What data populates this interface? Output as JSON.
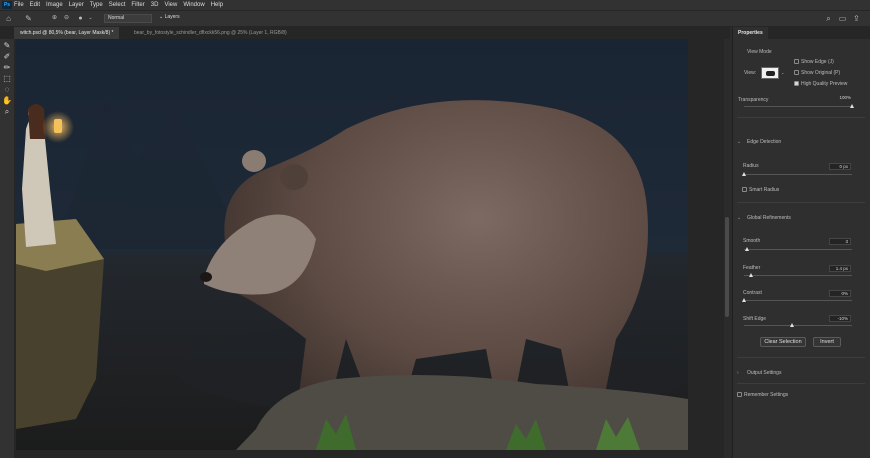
{
  "menubar": {
    "app_icon": "Ps",
    "items": [
      "File",
      "Edit",
      "Image",
      "Layer",
      "Type",
      "Select",
      "Filter",
      "3D",
      "View",
      "Window",
      "Help"
    ]
  },
  "options_bar": {
    "mode_value": "Normal",
    "layer_value": "Layers"
  },
  "document_tabs": [
    {
      "label": "witch.psd @ 80,5% (bear, Layer Mask/8) *",
      "active": true
    },
    {
      "label": "bear_by_fotostyle_schindler_dflxckk56.png @ 25% (Layer 1, RGB/8)",
      "active": false
    }
  ],
  "properties": {
    "tab_label": "Properties",
    "view_mode": {
      "label": "View Mode",
      "view_label": "View:",
      "show_edge": {
        "label": "Show Edge (J)",
        "checked": false
      },
      "show_original": {
        "label": "Show Original (P)",
        "checked": false
      },
      "hq_preview": {
        "label": "High Quality Preview",
        "checked": true
      }
    },
    "transparency": {
      "label": "Transparency",
      "value": "100%",
      "level": 1.0
    },
    "edge_detection": {
      "header": "Edge Detection",
      "radius": {
        "label": "Radius",
        "value": "0 px",
        "level": 0.0
      },
      "smart_radius": {
        "label": "Smart Radius",
        "checked": false
      }
    },
    "global_refinements": {
      "header": "Global Refinements",
      "smooth": {
        "label": "Smooth",
        "value": "3",
        "level": 0.03
      },
      "feather": {
        "label": "Feather",
        "value": "1.4 px",
        "level": 0.07
      },
      "contrast": {
        "label": "Contrast",
        "value": "0%",
        "level": 0.0
      },
      "shift_edge": {
        "label": "Shift Edge",
        "value": "-10%",
        "level": 0.45
      },
      "clear_selection": "Clear Selection",
      "invert": "Invert"
    },
    "output_settings": {
      "header": "Output Settings"
    },
    "remember_settings": {
      "label": "Remember Settings",
      "checked": false
    }
  },
  "icons": {
    "home": "home-icon",
    "brush": "brush-icon",
    "search": "search-icon",
    "workspace": "workspace-icon",
    "share": "share-icon"
  }
}
